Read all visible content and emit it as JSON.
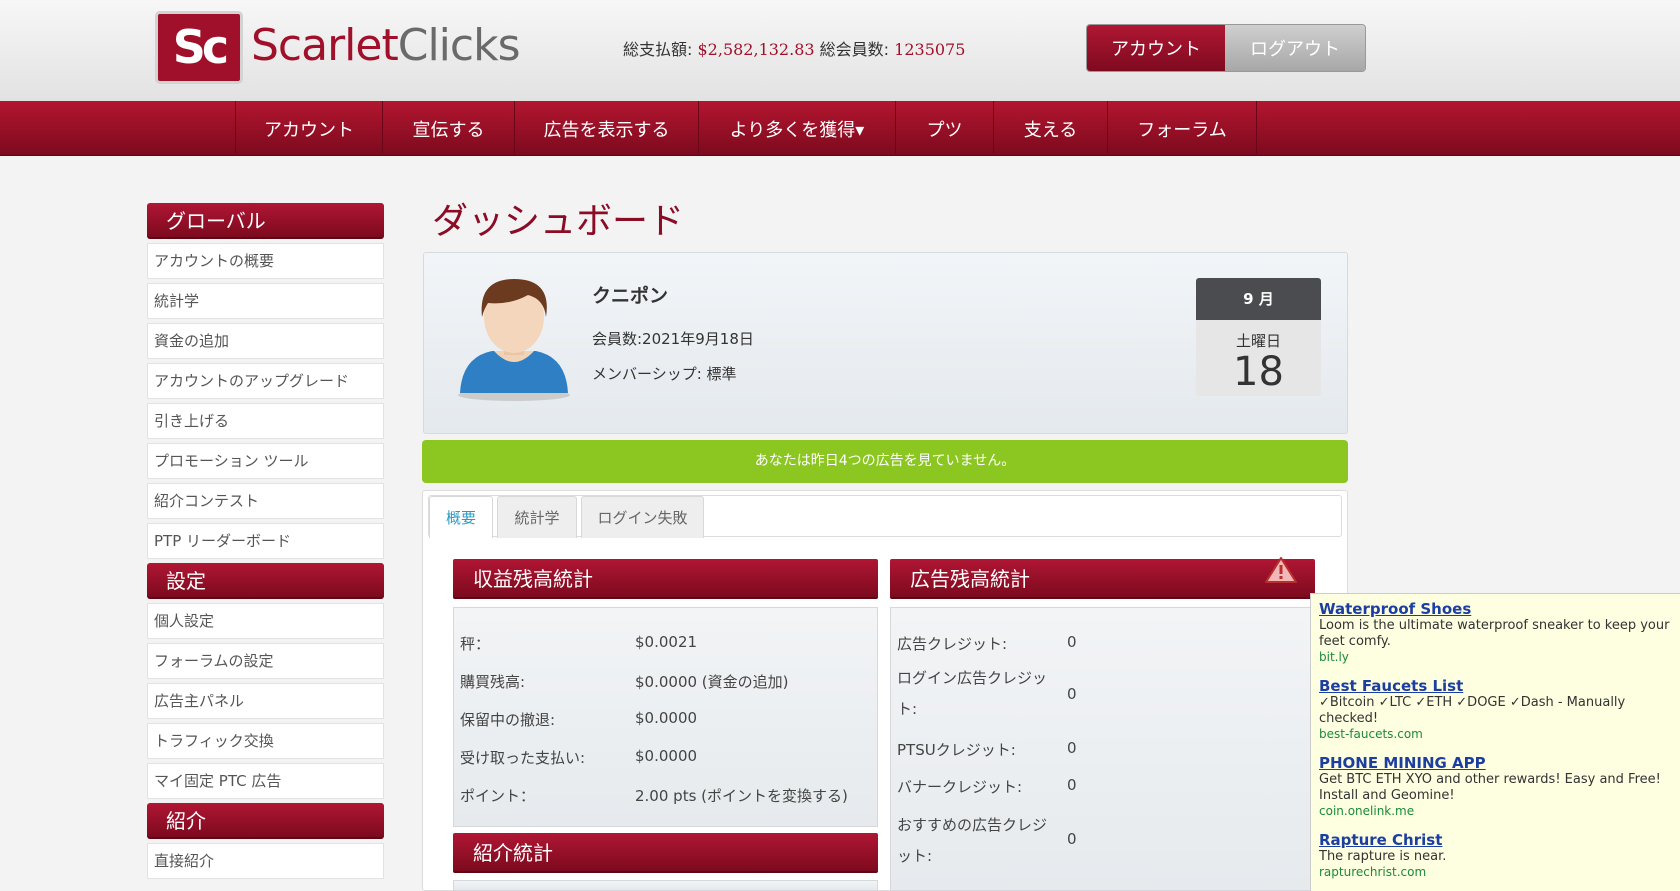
{
  "header": {
    "logo_mark": "Sc",
    "logo_scarlet": "Scarlet",
    "logo_clicks": "Clicks",
    "stats_paid_label": "総支払額:",
    "stats_paid_value": "$2,582,132.83",
    "stats_members_label": "総会員数:",
    "stats_members_value": "1235075",
    "account_button": "アカウント",
    "logout_button": "ログアウト"
  },
  "nav": {
    "items": [
      "アカウント",
      "宣伝する",
      "広告を表示する",
      "より多くを獲得▾",
      "プツ",
      "支える",
      "フォーラム"
    ]
  },
  "sidebar": {
    "sections": [
      {
        "title": "グローバル",
        "items": [
          "アカウントの概要",
          "統計学",
          "資金の追加",
          "アカウントのアップグレード",
          "引き上げる",
          "プロモーション ツール",
          "紹介コンテスト",
          "PTP リーダーボード"
        ]
      },
      {
        "title": "設定",
        "items": [
          "個人設定",
          "フォーラムの設定",
          "広告主パネル",
          "トラフィック交換",
          "マイ固定 PTC 広告"
        ]
      },
      {
        "title": "紹介",
        "items": [
          "直接紹介"
        ]
      }
    ]
  },
  "main": {
    "page_title": "ダッシュボード",
    "profile": {
      "username": "クニポン",
      "member_since": "会員数:2021年9月18日",
      "membership": "メンバーシップ: 標準"
    },
    "calendar": {
      "month": "9 月",
      "weekday": "土曜日",
      "day": "18"
    },
    "alert": "あなたは昨日4つの広告を見ていません。",
    "tabs": [
      "概要",
      "統計学",
      "ログイン失敗"
    ],
    "earnings_panel": {
      "title": "収益残高統計",
      "rows": [
        {
          "label": "秤：",
          "value": "$0.0021"
        },
        {
          "label": "購買残高:",
          "value": "$0.0000 (資金の追加)"
        },
        {
          "label": "保留中の撤退:",
          "value": "$0.0000"
        },
        {
          "label": "受け取った支払い:",
          "value": "$0.0000"
        },
        {
          "label": "ポイント：",
          "value": "2.00 pts (ポイントを変換する)"
        }
      ]
    },
    "ad_panel": {
      "title": "広告残高統計",
      "rows": [
        {
          "label": "広告クレジット:",
          "value": "0"
        },
        {
          "label1": "ログイン広告クレジッ",
          "label2": "ト:",
          "value": "0"
        },
        {
          "label": "PTSUクレジット:",
          "value": "0"
        },
        {
          "label": "バナークレジット:",
          "value": "0"
        },
        {
          "label1": "おすすめの広告クレジ",
          "label2": "ット:",
          "value": "0"
        }
      ]
    },
    "referral_panel": {
      "title": "紹介統計"
    }
  },
  "ads": [
    {
      "title": "Waterproof Shoes",
      "text": "Loom is the ultimate waterproof sneaker to keep your feet comfy.",
      "url": "bit.ly"
    },
    {
      "title": "Best Faucets List",
      "text": "✓Bitcoin ✓LTC ✓ETH ✓DOGE ✓Dash - Manually checked!",
      "url": "best-faucets.com"
    },
    {
      "title": "PHONE MINING APP",
      "text": "Get BTC ETH XYO and other rewards! Easy and Free! Install and Geomine!",
      "url": "coin.onelink.me"
    },
    {
      "title": "Rapture Christ",
      "text": "The rapture is near.",
      "url": "rapturechrist.com"
    }
  ]
}
